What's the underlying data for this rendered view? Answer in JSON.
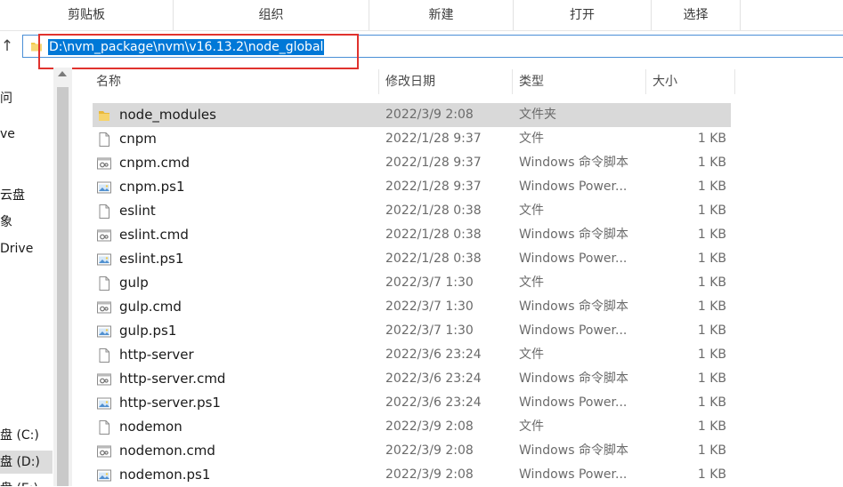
{
  "ribbon": {
    "groups": [
      "剪贴板",
      "组织",
      "新建",
      "打开",
      "选择"
    ]
  },
  "address": {
    "path": "D:\\nvm_package\\nvm\\v16.13.2\\node_global"
  },
  "nav": {
    "items": [
      {
        "label": "问"
      },
      {
        "label": "ve"
      },
      {
        "label": "云盘"
      },
      {
        "label": "象"
      },
      {
        "label": "Drive"
      },
      {
        "label": "盘 (C:)"
      },
      {
        "label": "盘 (D:)"
      },
      {
        "label": "盘 (E:)"
      }
    ]
  },
  "columns": {
    "name": "名称",
    "date": "修改日期",
    "type": "类型",
    "size": "大小"
  },
  "files": [
    {
      "name": "node_modules",
      "date": "2022/3/9 2:08",
      "type": "文件夹",
      "size": "",
      "icon": "folder-icon"
    },
    {
      "name": "cnpm",
      "date": "2022/1/28 9:37",
      "type": "文件",
      "size": "1 KB",
      "icon": "file-icon"
    },
    {
      "name": "cnpm.cmd",
      "date": "2022/1/28 9:37",
      "type": "Windows 命令脚本",
      "size": "1 KB",
      "icon": "cmd-icon"
    },
    {
      "name": "cnpm.ps1",
      "date": "2022/1/28 9:37",
      "type": "Windows Power...",
      "size": "1 KB",
      "icon": "ps1-icon"
    },
    {
      "name": "eslint",
      "date": "2022/1/28 0:38",
      "type": "文件",
      "size": "1 KB",
      "icon": "file-icon"
    },
    {
      "name": "eslint.cmd",
      "date": "2022/1/28 0:38",
      "type": "Windows 命令脚本",
      "size": "1 KB",
      "icon": "cmd-icon"
    },
    {
      "name": "eslint.ps1",
      "date": "2022/1/28 0:38",
      "type": "Windows Power...",
      "size": "1 KB",
      "icon": "ps1-icon"
    },
    {
      "name": "gulp",
      "date": "2022/3/7 1:30",
      "type": "文件",
      "size": "1 KB",
      "icon": "file-icon"
    },
    {
      "name": "gulp.cmd",
      "date": "2022/3/7 1:30",
      "type": "Windows 命令脚本",
      "size": "1 KB",
      "icon": "cmd-icon"
    },
    {
      "name": "gulp.ps1",
      "date": "2022/3/7 1:30",
      "type": "Windows Power...",
      "size": "1 KB",
      "icon": "ps1-icon"
    },
    {
      "name": "http-server",
      "date": "2022/3/6 23:24",
      "type": "文件",
      "size": "1 KB",
      "icon": "file-icon"
    },
    {
      "name": "http-server.cmd",
      "date": "2022/3/6 23:24",
      "type": "Windows 命令脚本",
      "size": "1 KB",
      "icon": "cmd-icon"
    },
    {
      "name": "http-server.ps1",
      "date": "2022/3/6 23:24",
      "type": "Windows Power...",
      "size": "1 KB",
      "icon": "ps1-icon"
    },
    {
      "name": "nodemon",
      "date": "2022/3/9 2:08",
      "type": "文件",
      "size": "1 KB",
      "icon": "file-icon"
    },
    {
      "name": "nodemon.cmd",
      "date": "2022/3/9 2:08",
      "type": "Windows 命令脚本",
      "size": "1 KB",
      "icon": "cmd-icon"
    },
    {
      "name": "nodemon.ps1",
      "date": "2022/3/9 2:08",
      "type": "Windows Power...",
      "size": "1 KB",
      "icon": "ps1-icon"
    }
  ],
  "colors": {
    "selection": "#0078d7",
    "annotation": "#e0322e",
    "row_selected": "#d9d9d9"
  }
}
